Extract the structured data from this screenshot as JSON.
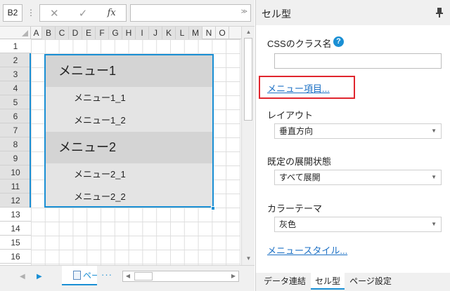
{
  "formula_bar": {
    "cell_name": "B2",
    "menu_glyph": "⋮",
    "cancel_glyph": "✕",
    "confirm_glyph": "✓",
    "fx_label": "fx",
    "formula_value": "",
    "expand_glyph": "≫"
  },
  "sheet": {
    "columns": [
      "A",
      "B",
      "C",
      "D",
      "E",
      "F",
      "G",
      "H",
      "I",
      "J",
      "K",
      "L",
      "M",
      "N",
      "O"
    ],
    "selected_columns": [
      "B",
      "C",
      "D",
      "E",
      "F",
      "G",
      "H",
      "I",
      "J",
      "K",
      "L",
      "M"
    ],
    "rows": [
      "1",
      "2",
      "3",
      "4",
      "5",
      "6",
      "7",
      "8",
      "9",
      "10",
      "11",
      "12",
      "13",
      "14",
      "15",
      "16"
    ],
    "selected_rows": [
      "2",
      "3",
      "4",
      "5",
      "6",
      "7",
      "8",
      "9",
      "10",
      "11",
      "12"
    ],
    "menu": {
      "group1": "メニュー1",
      "item1_1": "メニュー1_1",
      "item1_2": "メニュー1_2",
      "group2": "メニュー2",
      "item2_1": "メニュー2_1",
      "item2_2": "メニュー2_2"
    },
    "selection_color": "#1a8fd4"
  },
  "bottom_bar": {
    "prev_glyph": "◀",
    "next_glyph": "▶",
    "sheet_tab_label": "ページ",
    "more_glyph": "···",
    "scroll_left_glyph": "◀",
    "scroll_right_glyph": "▶"
  },
  "vscroll": {
    "up_glyph": "▲",
    "down_glyph": "▼"
  },
  "panel": {
    "title": "セル型",
    "css_class_label": "CSSのクラス名",
    "css_help_glyph": "?",
    "css_class_value": "",
    "menu_items_link": "メニュー項目...",
    "layout_label": "レイアウト",
    "layout_value": "垂直方向",
    "default_expand_label": "既定の展開状態",
    "default_expand_value": "すべて展開",
    "color_theme_label": "カラーテーマ",
    "color_theme_value": "灰色",
    "menu_style_link": "メニュースタイル...",
    "caret_glyph": "▼",
    "tabs": [
      "データ連結",
      "セル型",
      "ページ設定"
    ],
    "active_tab": "セル型",
    "highlight_color": "#e0262e"
  }
}
